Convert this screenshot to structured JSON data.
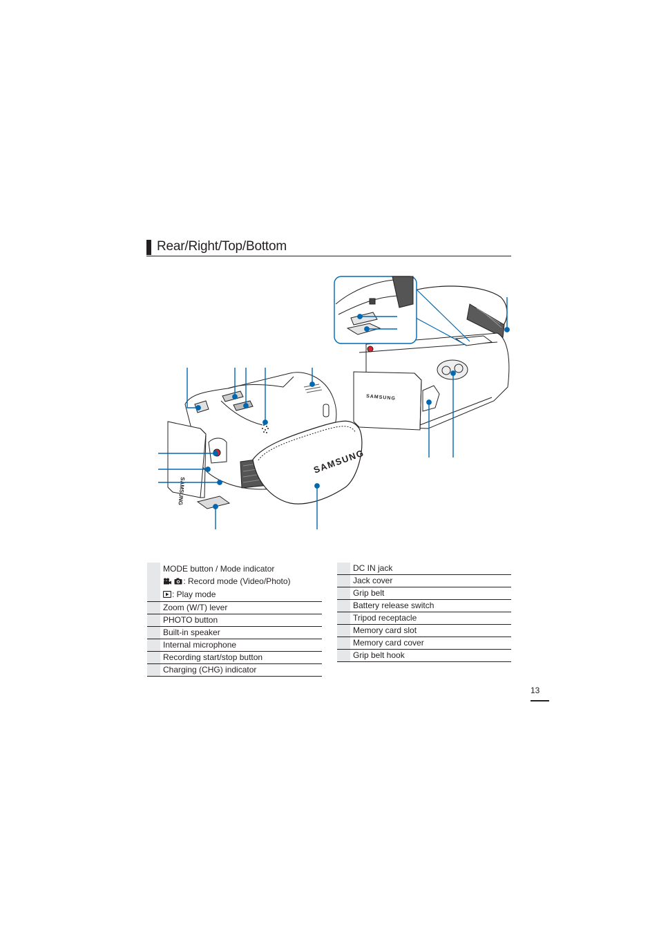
{
  "section": {
    "title": "Rear/Right/Top/Bottom"
  },
  "figure": {
    "brand_text": "SAMSUNG",
    "callout_color": "#0067b1",
    "inset_border_color": "#0067b1"
  },
  "left_table": {
    "rows": [
      {
        "number": "",
        "label": "MODE button / Mode indicator",
        "sub_lines": [
          {
            "icons": [
              "video-camera-icon",
              "photo-camera-icon"
            ],
            "text": ": Record mode (Video/Photo)"
          },
          {
            "icons": [
              "play-mode-icon"
            ],
            "text": ": Play mode"
          }
        ]
      },
      {
        "number": "",
        "label": "Zoom (W/T) lever"
      },
      {
        "number": "",
        "label": "PHOTO button"
      },
      {
        "number": "",
        "label": "Built-in speaker"
      },
      {
        "number": "",
        "label": "Internal microphone"
      },
      {
        "number": "",
        "label": "Recording start/stop button"
      },
      {
        "number": "",
        "label": "Charging (CHG) indicator"
      }
    ]
  },
  "right_table": {
    "rows": [
      {
        "number": "",
        "label": "DC IN jack"
      },
      {
        "number": "",
        "label": "Jack cover"
      },
      {
        "number": "",
        "label": "Grip belt"
      },
      {
        "number": "",
        "label": "Battery release switch"
      },
      {
        "number": "",
        "label": "Tripod receptacle"
      },
      {
        "number": "",
        "label": "Memory card slot"
      },
      {
        "number": "",
        "label": "Memory card cover"
      },
      {
        "number": "",
        "label": "Grip belt hook"
      }
    ]
  },
  "footer": {
    "page_number": "13"
  }
}
